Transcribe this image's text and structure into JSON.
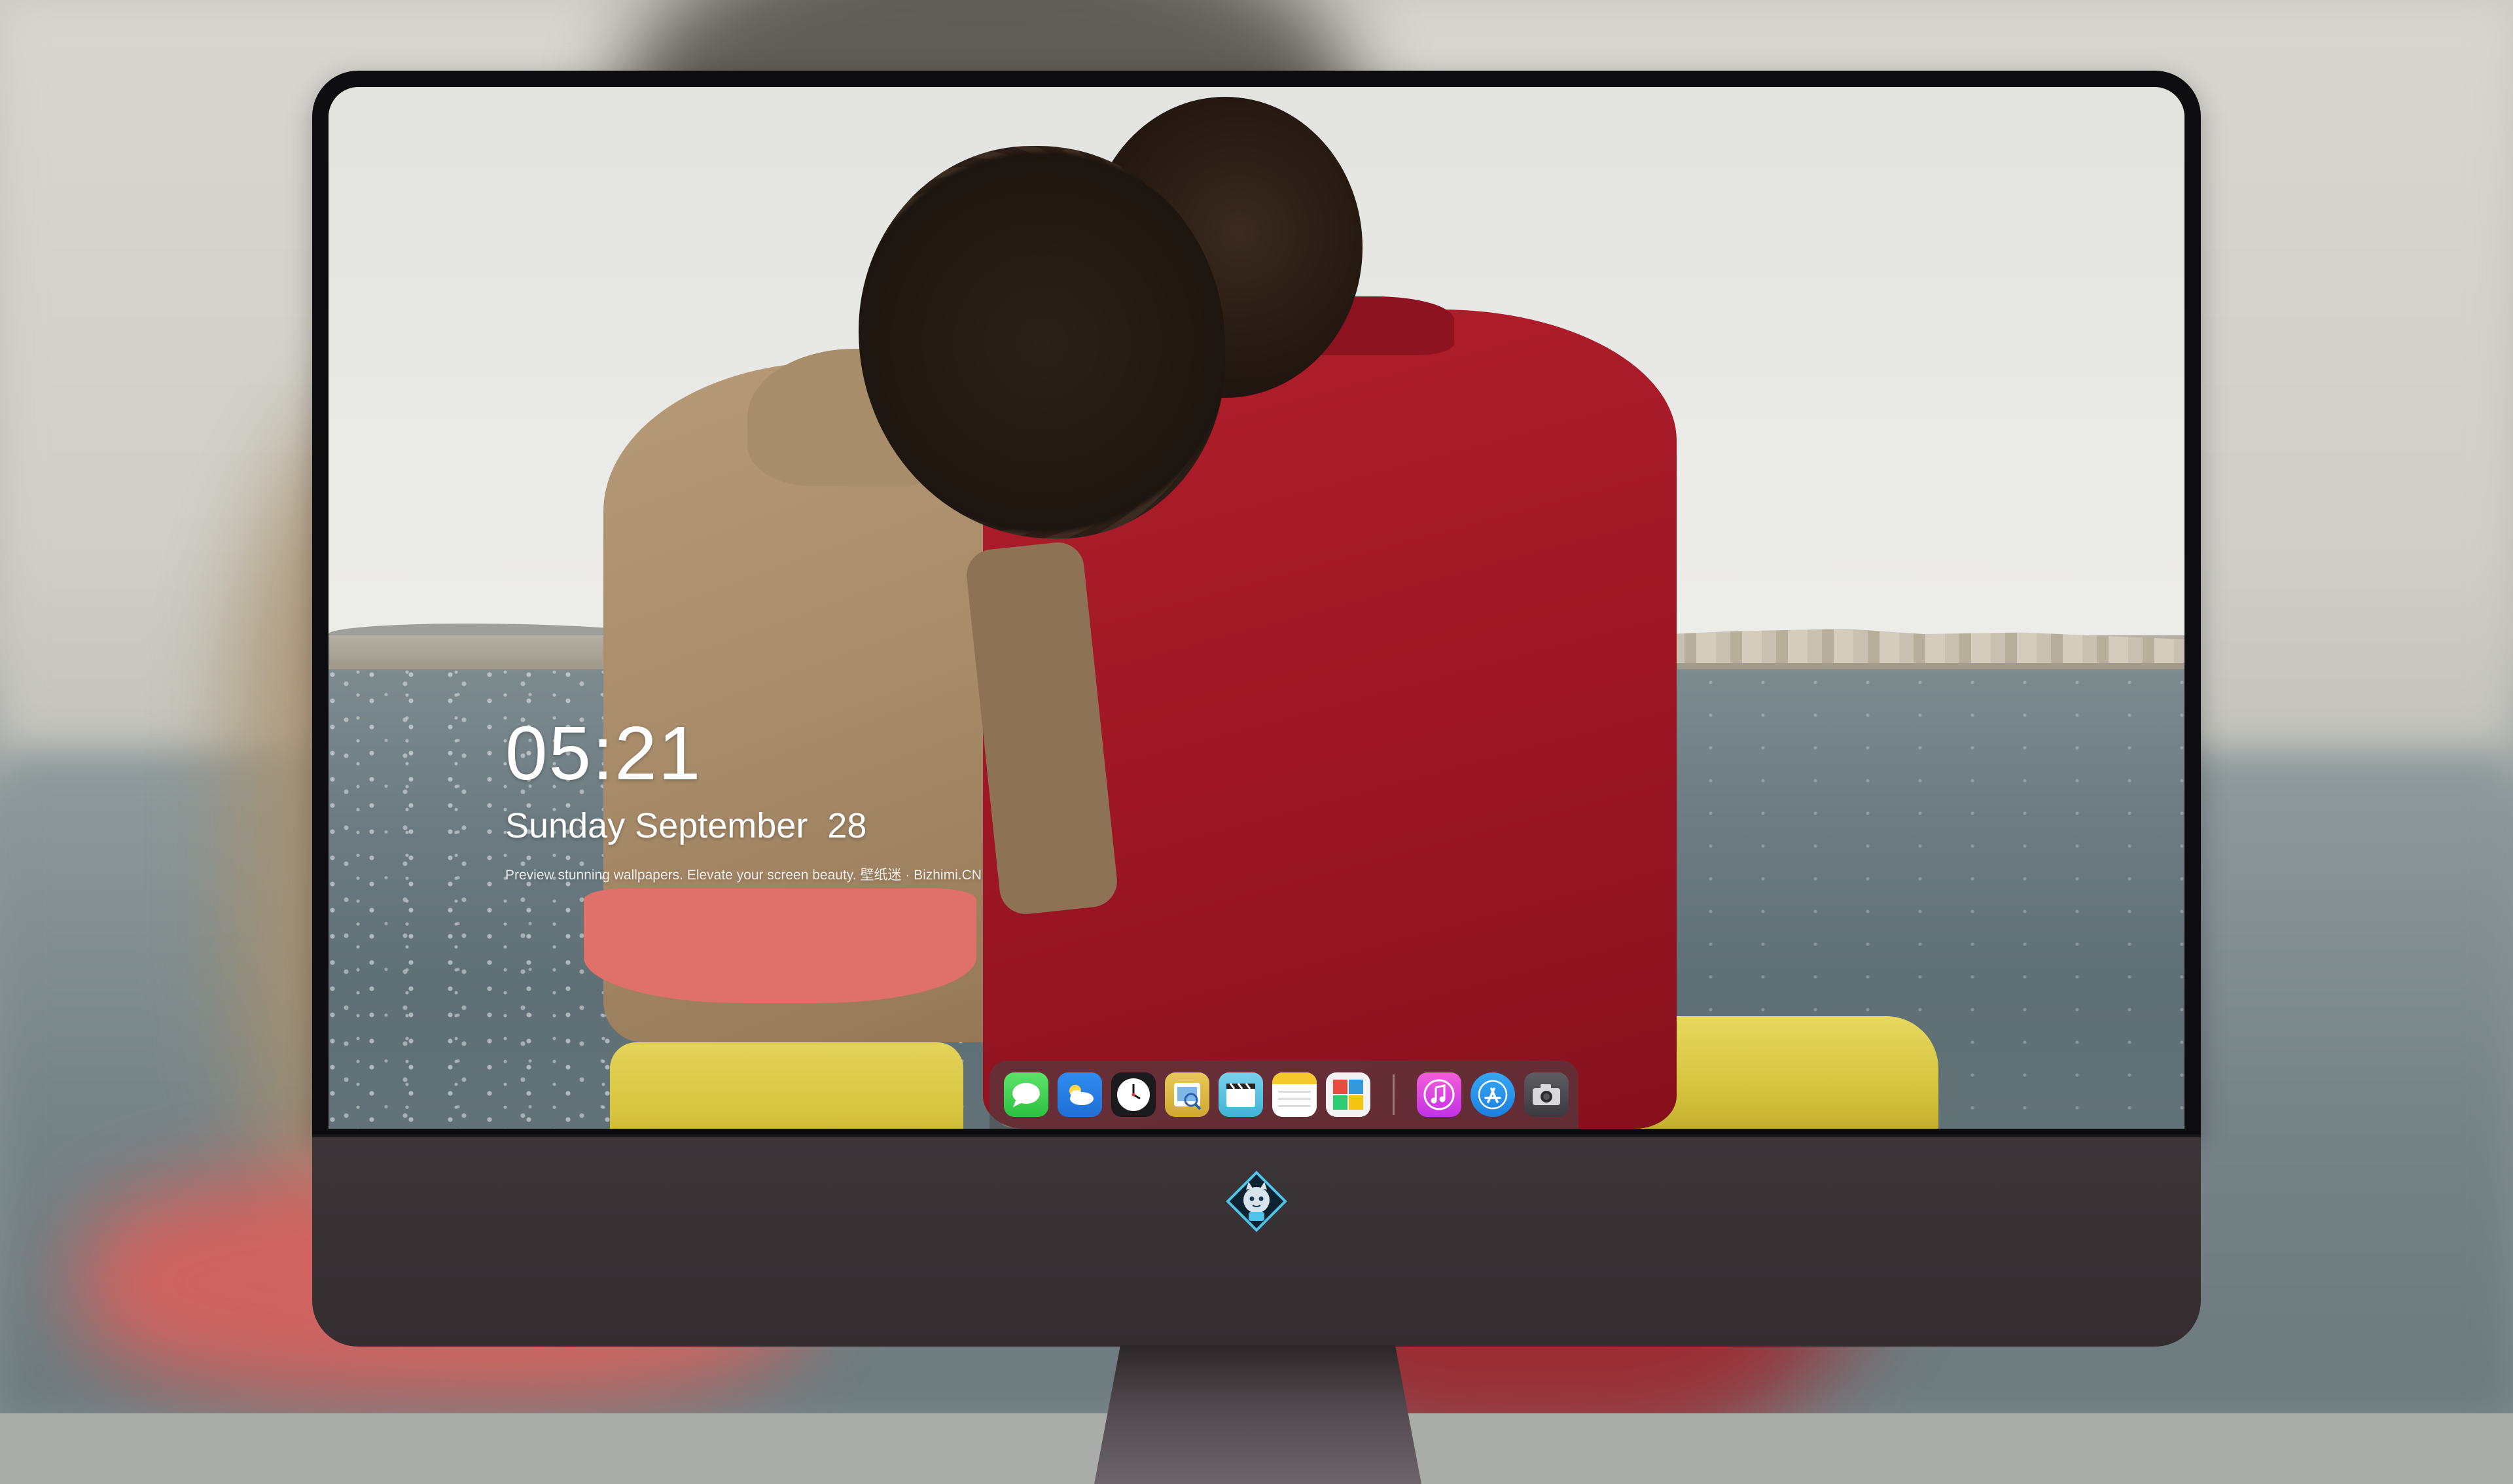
{
  "lock_screen": {
    "time": "05:21",
    "date": "Sunday September  28",
    "tagline": "Preview stunning wallpapers. Elevate your screen beauty. 壁纸迷 · Bizhimi.CN"
  },
  "dock": {
    "apps": [
      {
        "name": "Messages",
        "icon": "messages-icon"
      },
      {
        "name": "Weather",
        "icon": "weather-icon"
      },
      {
        "name": "Clock",
        "icon": "clock-icon"
      },
      {
        "name": "Preview",
        "icon": "preview-icon"
      },
      {
        "name": "Clips",
        "icon": "clips-icon"
      },
      {
        "name": "Notes",
        "icon": "notes-icon"
      },
      {
        "name": "Photo Booth",
        "icon": "photo-gallery-icon"
      },
      {
        "name": "iTunes",
        "icon": "music-icon"
      },
      {
        "name": "App Store",
        "icon": "app-store-icon"
      },
      {
        "name": "Camera",
        "icon": "camera-icon"
      }
    ]
  },
  "colors": {
    "shirt_red": "#9d1624",
    "sweater_tan": "#a68a68",
    "water": "#6b7b80",
    "seat_yellow": "#d8c540",
    "monitor_chin": "#3c3538"
  }
}
